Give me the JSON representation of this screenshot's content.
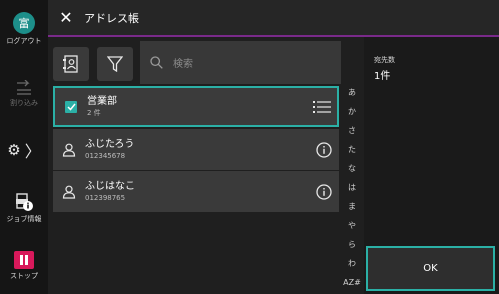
{
  "rail": {
    "logout_icon_char": "富",
    "logout_label": "ログアウト",
    "interrupt_label": "割り込み",
    "jobinfo_label": "ジョブ情報",
    "stop_label": "ストップ"
  },
  "header": {
    "title": "アドレス帳"
  },
  "search": {
    "placeholder": "検索"
  },
  "list": {
    "items": [
      {
        "name": "営業部",
        "sub": "2 件",
        "type": "group",
        "selected": true
      },
      {
        "name": "ふじたろう",
        "sub": "012345678",
        "type": "person",
        "selected": false
      },
      {
        "name": "ふじはなこ",
        "sub": "012398765",
        "type": "person",
        "selected": false
      }
    ]
  },
  "index": [
    "あ",
    "か",
    "さ",
    "た",
    "な",
    "は",
    "ま",
    "や",
    "ら",
    "わ",
    "AZ#"
  ],
  "panel": {
    "count_label": "宛先数",
    "count_value": "1件",
    "ok_label": "OK"
  },
  "colors": {
    "accent": "#2bb0a6",
    "header_line": "#7a2a8a",
    "stop": "#d8195b",
    "logout": "#1d8f8a"
  }
}
